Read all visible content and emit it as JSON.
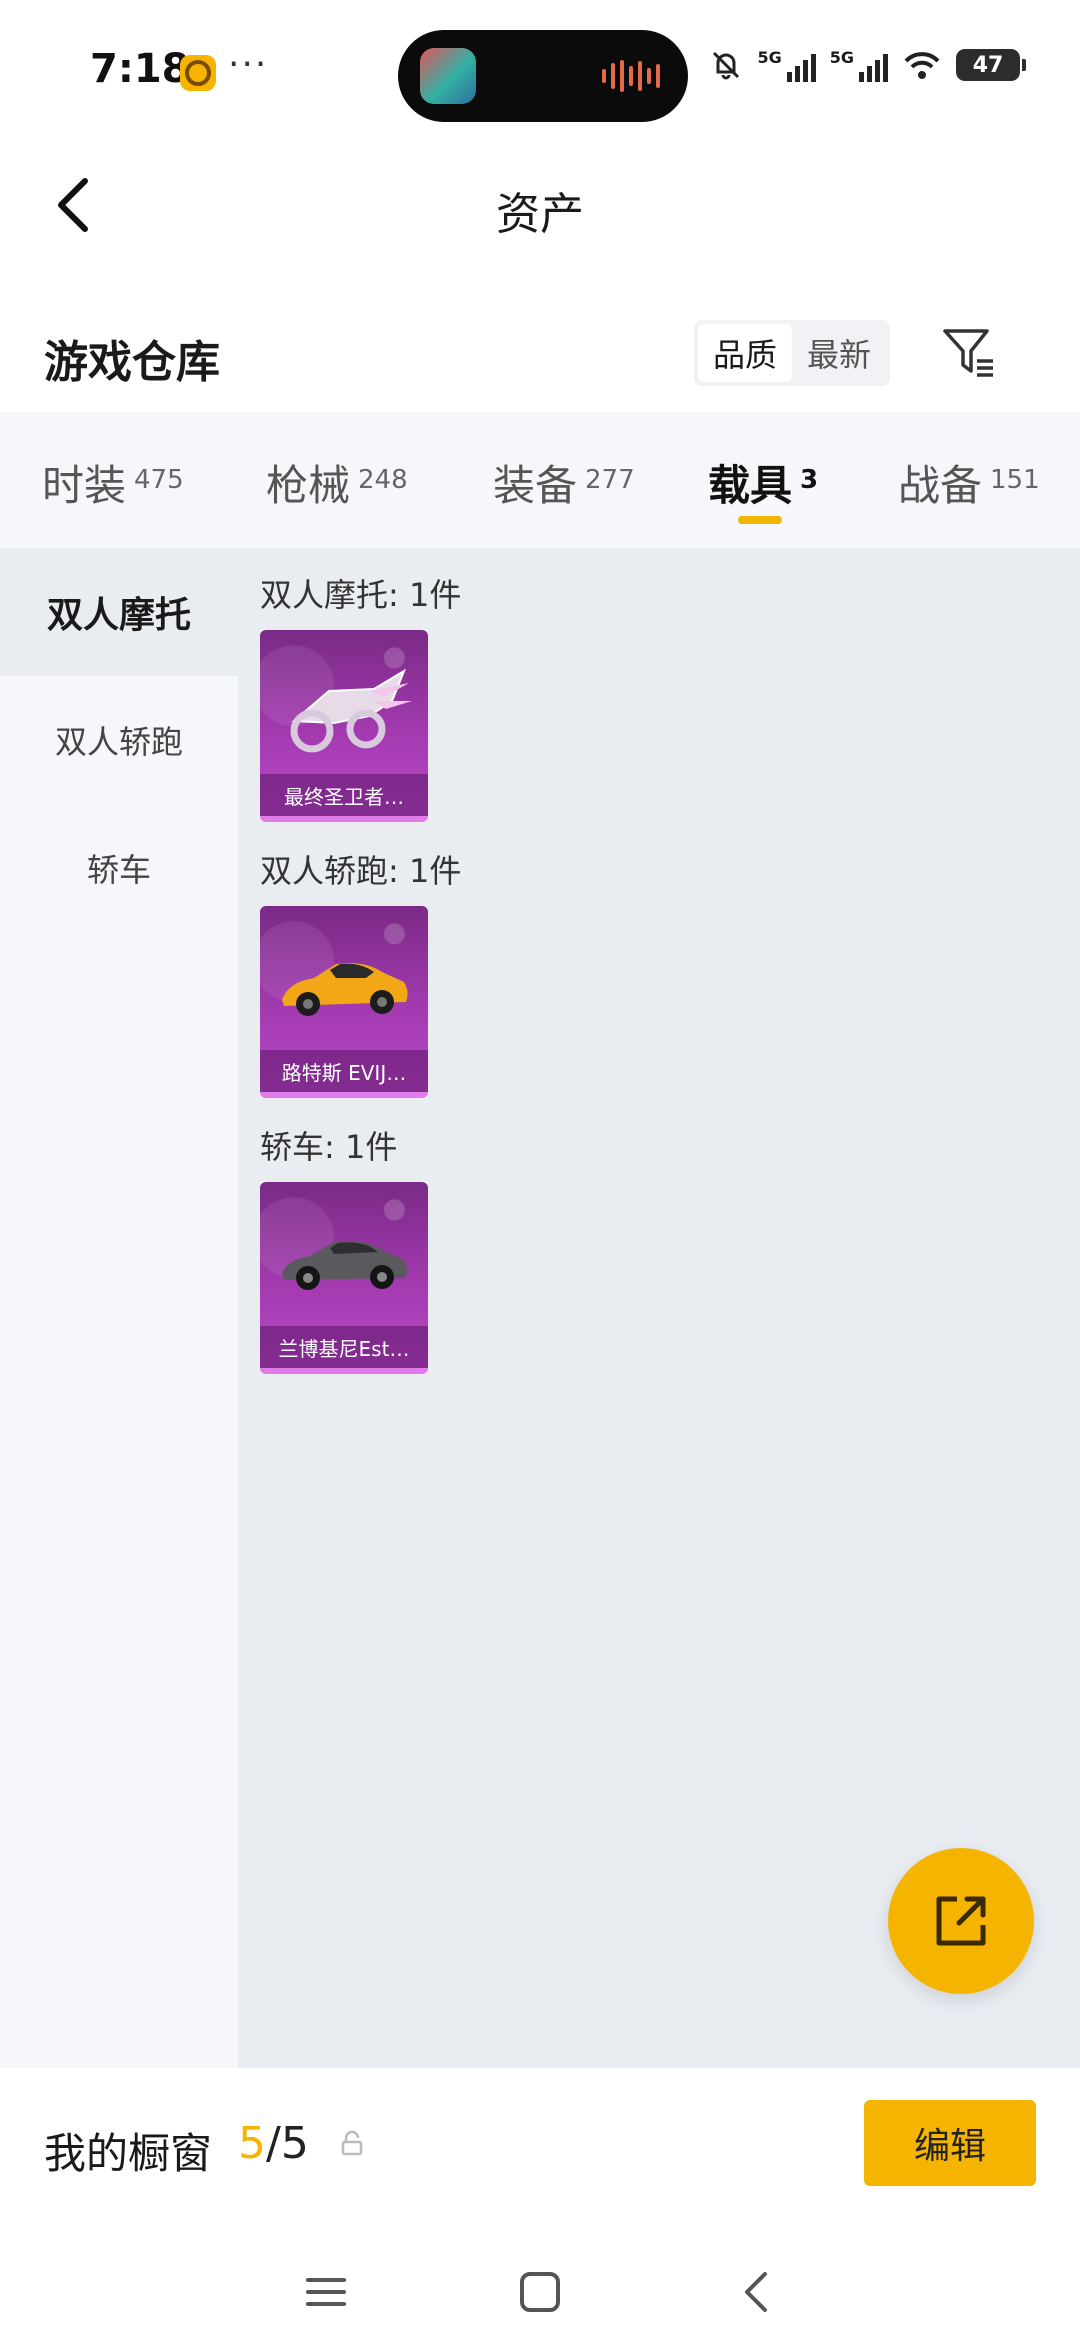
{
  "status_bar": {
    "time": "7:18",
    "dots": "···",
    "signal1_label": "5G",
    "signal2_label": "5G",
    "battery": "47"
  },
  "header": {
    "title": "资产"
  },
  "warehouse": {
    "title": "游戏仓库",
    "sort_options": [
      "品质",
      "最新"
    ],
    "active_sort": "品质"
  },
  "tabs": [
    {
      "label": "时装",
      "count": "475"
    },
    {
      "label": "枪械",
      "count": "248"
    },
    {
      "label": "装备",
      "count": "277"
    },
    {
      "label": "载具",
      "count": "3"
    },
    {
      "label": "战备",
      "count": "151"
    }
  ],
  "active_tab": "载具",
  "sidebar": {
    "items": [
      "双人摩托",
      "双人轿跑",
      "轿车"
    ],
    "active": "双人摩托"
  },
  "groups": [
    {
      "title": "双人摩托: 1件",
      "items": [
        {
          "name": "最终圣卫者…",
          "icon": "motorcycle-icon"
        }
      ]
    },
    {
      "title": "双人轿跑: 1件",
      "items": [
        {
          "name": "路特斯 EVIJ…",
          "icon": "sports-car-icon"
        }
      ]
    },
    {
      "title": "轿车: 1件",
      "items": [
        {
          "name": "兰博基尼Est…",
          "icon": "sedan-icon"
        }
      ]
    }
  ],
  "showcase": {
    "label": "我的橱窗",
    "current": "5",
    "separator": "/",
    "total": "5"
  },
  "edit_label": "编辑",
  "colors": {
    "accent": "#f5b400",
    "card_purple": "#a33ab0",
    "page_bg": "#e9edf2"
  }
}
